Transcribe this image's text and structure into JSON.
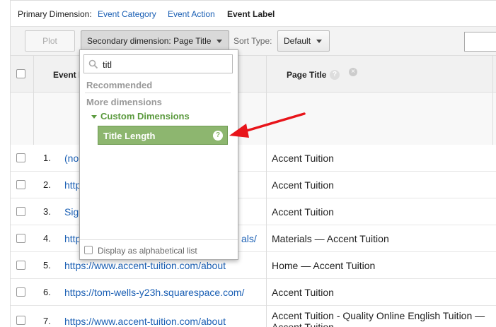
{
  "primary": {
    "label": "Primary Dimension:",
    "options": [
      "Event Category",
      "Event Action",
      "Event Label"
    ],
    "active": "Event Label"
  },
  "toolbar": {
    "plot_rows": "Plot Rows",
    "secondary_dimension": "Secondary dimension: Page Title",
    "sort_type_label": "Sort Type:",
    "sort_type_value": "Default"
  },
  "table": {
    "col_event_label": "Event Label",
    "col_event_label_visible": "Event L",
    "col_page_title": "Page Title",
    "rows": [
      {
        "num": "1.",
        "label": "(not set)",
        "label_visible": "(no",
        "page_title": "Accent Tuition"
      },
      {
        "num": "2.",
        "label": "https://...",
        "label_visible": "http",
        "page_title": "Accent Tuition"
      },
      {
        "num": "3.",
        "label": "Sign...",
        "label_visible": "Sig",
        "page_title": "Accent Tuition"
      },
      {
        "num": "4.",
        "label": "https://www.accent-tuition.com/materials/",
        "label_visible_left": "http",
        "label_visible_right": "als/",
        "page_title": "Materials — Accent Tuition"
      },
      {
        "num": "5.",
        "label": "https://www.accent-tuition.com/about",
        "page_title": "Home — Accent Tuition"
      },
      {
        "num": "6.",
        "label": "https://tom-wells-y23h.squarespace.com/",
        "page_title": "Accent Tuition"
      },
      {
        "num": "7.",
        "label": "https://www.accent-tuition.com/about",
        "page_title": "Accent Tuition - Quality Online English Tuition —",
        "page_title_line2": "Accent Tuition"
      }
    ]
  },
  "dropdown": {
    "search_value": "titl",
    "recommended": "Recommended",
    "more_dimensions": "More dimensions",
    "group": "Custom Dimensions",
    "item": "Title Length",
    "footer": "Display as alphabetical list"
  },
  "colors": {
    "link": "#1a5fb4",
    "highlight_item": "#8db66f",
    "group_text": "#5b9a3e",
    "annotation_arrow": "#e8141a"
  }
}
